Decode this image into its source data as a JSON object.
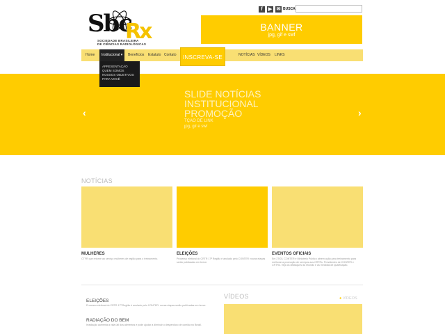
{
  "logo": {
    "mark": "Sbc",
    "mark_rx": "Rx",
    "subtitle_line1": "SOCIEDADE BRASILEIRA",
    "subtitle_line2": "DE CIÊNCIAS RADIOLÓGICAS"
  },
  "header": {
    "social_icons": [
      "facebook-icon",
      "youtube-icon",
      "email-icon"
    ],
    "search_label": "BUSCA",
    "search_value": ""
  },
  "banner": {
    "title": "BANNER",
    "subtitle": "jpg, gif e swf"
  },
  "nav": {
    "items": {
      "home": "Home",
      "institucional": "Institucional ▾",
      "beneficios": "Benefícios",
      "estatuto": "Estatuto",
      "contato": "Contato",
      "noticias": "NOTÍCIAS",
      "videos": "VÍDEOS",
      "links": "LINKS"
    },
    "cta": "INSCREVA-SE",
    "dropdown": [
      "APRESENTAÇÃO",
      "QUEM SOMOS",
      "NOSSOS OBJETIVOS",
      "PARA VOCÊ"
    ]
  },
  "slider": {
    "line1": "SLIDE NOTÍCIAS",
    "line2": "INSTITUCIONAL",
    "line3": "PROMOÇÃO",
    "line4": "TÇÃO DE LINK",
    "line5": "jpg, gif e swf",
    "prev": "‹",
    "next": "›"
  },
  "news": {
    "section_title": "NOTÍCIAS",
    "cards": [
      {
        "title": "MULHERES",
        "desc": "CTFR que retorne ao serviço mulheres de região para o treinamento."
      },
      {
        "title": "ELEIÇÕES",
        "desc": "Processo eleitoral do CRTR 17ª Região é anulado pelo CONTER: novas etapas serão publicadas em breve."
      },
      {
        "title": "EVENTOS OFICIAIS",
        "desc": "Em 27/03, CONTER e Ministério Público abrem ação para treinamento para melhorar a promoção de serviços aos CRTRs. Presidentes de CONTER e CRTRs. Veja os destaques da reunião e as medidas de qualificação."
      }
    ]
  },
  "bottom": {
    "items": [
      {
        "title": "ELEIÇÕES",
        "desc": "Processo eleitoral do CRTR 17ª Região é anulado pelo CONTER: novas etapas serão publicadas em breve."
      },
      {
        "title": "RADIAÇÃO DO BEM",
        "desc": "Irradiação aumenta a vida útil dos alimentos e pode ajudar a diminuir o desperdício de comida no Brasil."
      }
    ],
    "videos_title": "VÍDEOS",
    "videos_link": "VÍDEOS"
  },
  "colors": {
    "accent": "#ffcc00",
    "accent_light": "#f9df73",
    "nav_dark": "#222222"
  }
}
